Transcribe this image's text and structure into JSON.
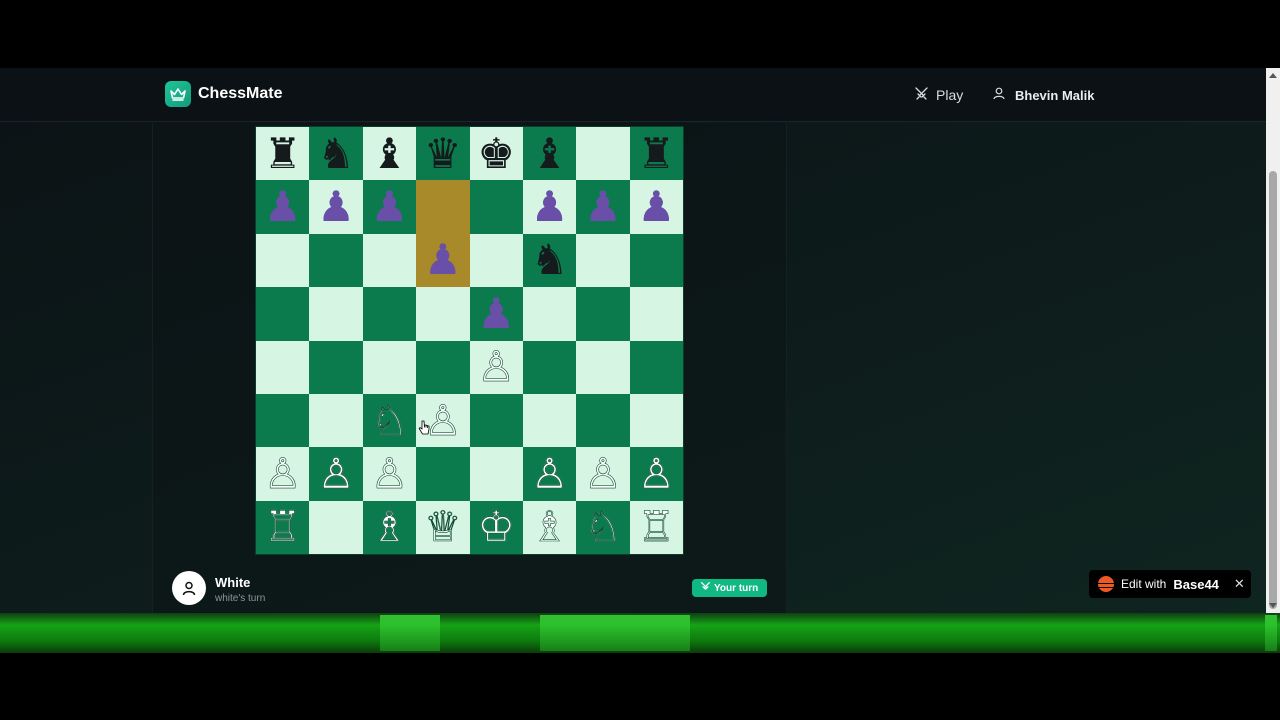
{
  "app": {
    "name": "ChessMate",
    "logo_icon": "crown-icon",
    "accent": "#10b981"
  },
  "nav": {
    "play_label": "Play",
    "user_name": "Bhevin Malik"
  },
  "board": {
    "light_color": "#d6f5e3",
    "dark_color": "#0b7a4c",
    "highlight_color": "#a98a2b",
    "highlighted_squares": [
      "d7",
      "d6"
    ],
    "ranks": [
      [
        "bR",
        "bN",
        "bB",
        "bQ",
        "bK",
        "bB",
        "",
        ""
      ],
      [
        "bP",
        "bP",
        "bP",
        "",
        "",
        "bP",
        "bP",
        "bP"
      ],
      [
        "",
        "",
        "",
        "bP",
        "",
        "bN",
        "",
        ""
      ],
      [
        "",
        "",
        "",
        "",
        "bP",
        "",
        "",
        ""
      ],
      [
        "",
        "",
        "",
        "",
        "wP",
        "",
        "",
        ""
      ],
      [
        "",
        "",
        "wN",
        "wP",
        "",
        "",
        "",
        ""
      ],
      [
        "wP",
        "wP",
        "wP",
        "",
        "",
        "wP",
        "wP",
        "wP"
      ],
      [
        "wR",
        "",
        "wB",
        "wQ",
        "wK",
        "wB",
        "wN",
        "wR"
      ]
    ],
    "h8_piece": "bR"
  },
  "player": {
    "name": "White",
    "status": "white's turn",
    "avatar_icon": "user-icon"
  },
  "turn_badge": {
    "label": "Your turn",
    "icon": "swords-icon"
  },
  "edit_badge": {
    "prefix": "Edit with",
    "brand": "Base44"
  }
}
